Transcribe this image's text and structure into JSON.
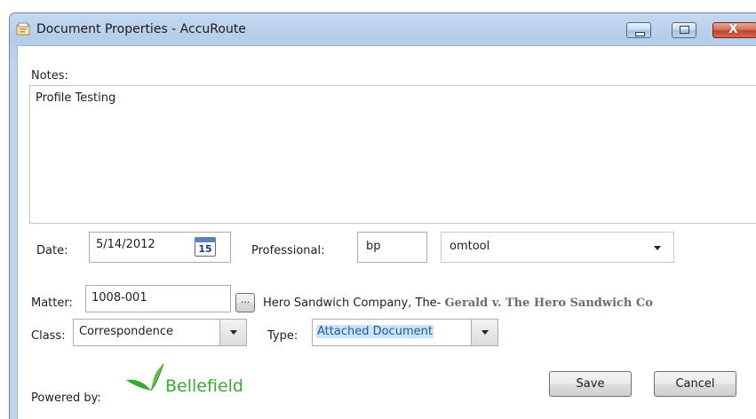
{
  "window": {
    "title": "Document Properties - AccuRoute",
    "title_icon": "app-doc-icon"
  },
  "caption": {
    "minimize_icon": "minimize-icon",
    "maximize_icon": "maximize-icon",
    "close_icon": "close-icon",
    "close_glyph": "X"
  },
  "notes": {
    "label": "Notes:",
    "value": "Profile Testing"
  },
  "date": {
    "label": "Date:",
    "value": "5/14/2012",
    "calendar_day": "15",
    "calendar_icon": "calendar-icon"
  },
  "professional": {
    "label": "Professional:",
    "code": "bp",
    "name": "omtool"
  },
  "matter": {
    "label": "Matter:",
    "value": "1008-001",
    "browse_label": "...",
    "client": "Hero Sandwich Company, The-",
    "matter_name": "Gerald v. The Hero Sandwich Co"
  },
  "class": {
    "label": "Class:",
    "value": "Correspondence"
  },
  "type": {
    "label": "Type:",
    "value": "Attached Document"
  },
  "footer": {
    "powered_by": "Powered by:",
    "brand": "Bellefield",
    "brand_color": "#3aa935",
    "save_label": "Save",
    "cancel_label": "Cancel"
  }
}
